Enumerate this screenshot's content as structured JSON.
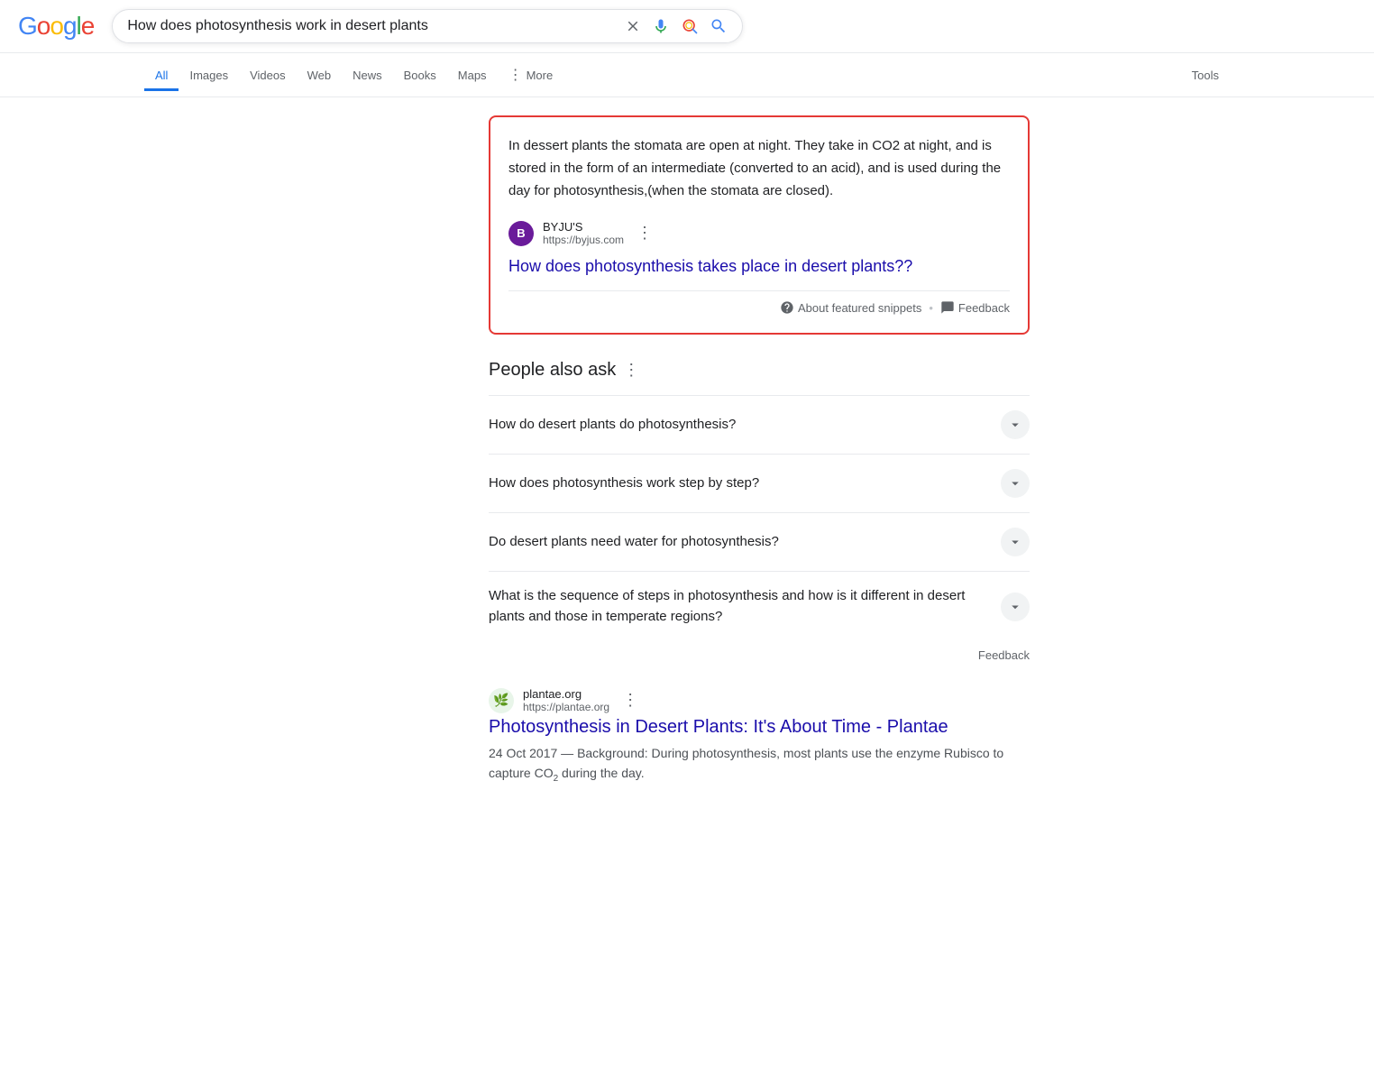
{
  "header": {
    "logo": {
      "letters": [
        "G",
        "o",
        "o",
        "g",
        "l",
        "e"
      ]
    },
    "search_query": "How does photosynthesis work in desert plants",
    "search_placeholder": "Search"
  },
  "nav": {
    "items": [
      {
        "id": "all",
        "label": "All",
        "active": true
      },
      {
        "id": "images",
        "label": "Images",
        "active": false
      },
      {
        "id": "videos",
        "label": "Videos",
        "active": false
      },
      {
        "id": "web",
        "label": "Web",
        "active": false
      },
      {
        "id": "news",
        "label": "News",
        "active": false
      },
      {
        "id": "books",
        "label": "Books",
        "active": false
      },
      {
        "id": "maps",
        "label": "Maps",
        "active": false
      }
    ],
    "more_label": "More",
    "tools_label": "Tools"
  },
  "featured_snippet": {
    "text": "In dessert plants the stomata are open at night. They take in CO2 at night, and is stored in the form of an intermediate (converted to an acid), and is used during the day for photosynthesis,(when the stomata are closed).",
    "source_name": "BYJU'S",
    "source_url": "https://byjus.com",
    "source_icon_letter": "B",
    "link_text": "How does photosynthesis takes place in desert plants??",
    "about_snippets_label": "About featured snippets",
    "feedback_label": "Feedback"
  },
  "people_also_ask": {
    "heading": "People also ask",
    "questions": [
      "How do desert plants do photosynthesis?",
      "How does photosynthesis work step by step?",
      "Do desert plants need water for photosynthesis?",
      "What is the sequence of steps in photosynthesis and how is it different in desert plants and those in temperate regions?"
    ],
    "feedback_label": "Feedback"
  },
  "search_result": {
    "source_name": "plantae.org",
    "source_url": "https://plantae.org",
    "source_icon": "🌿",
    "title": "Photosynthesis in Desert Plants: It's About Time - Plantae",
    "date": "24 Oct 2017",
    "description": "Background: During photosynthesis, most plants use the enzyme Rubisco to capture CO",
    "description_sub": "2",
    "description_end": " during the day."
  }
}
